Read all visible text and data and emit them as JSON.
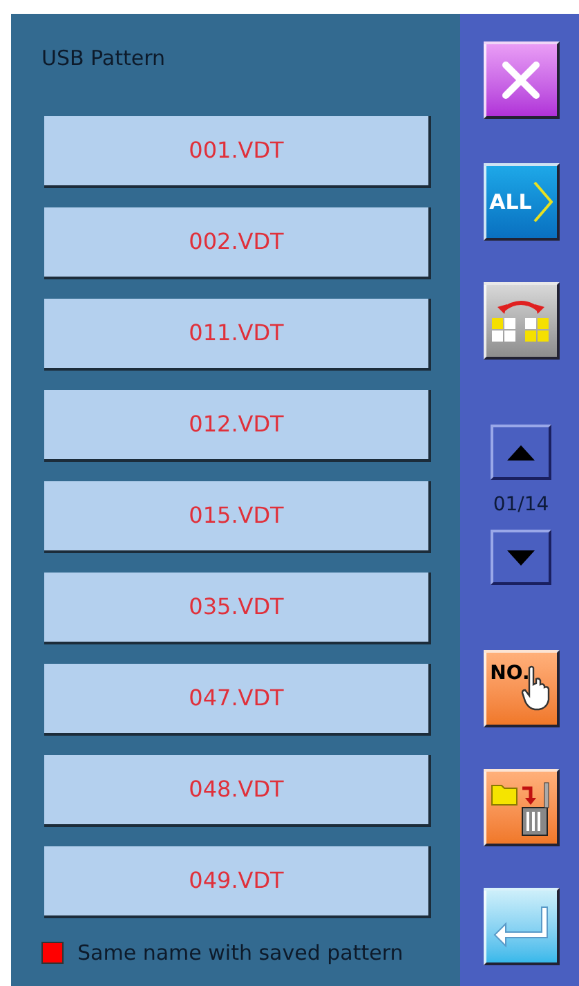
{
  "title": "USB Pattern",
  "patterns": [
    {
      "name": "001.VDT",
      "same_name": true
    },
    {
      "name": "002.VDT",
      "same_name": true
    },
    {
      "name": "011.VDT",
      "same_name": true
    },
    {
      "name": "012.VDT",
      "same_name": true
    },
    {
      "name": "015.VDT",
      "same_name": true
    },
    {
      "name": "035.VDT",
      "same_name": true
    },
    {
      "name": "047.VDT",
      "same_name": true
    },
    {
      "name": "048.VDT",
      "same_name": true
    },
    {
      "name": "049.VDT",
      "same_name": true
    }
  ],
  "legend": {
    "label": "Same name with saved pattern",
    "color": "#ff0000"
  },
  "all_button": "ALL",
  "page_indicator": "01/14",
  "number_button": "NO."
}
